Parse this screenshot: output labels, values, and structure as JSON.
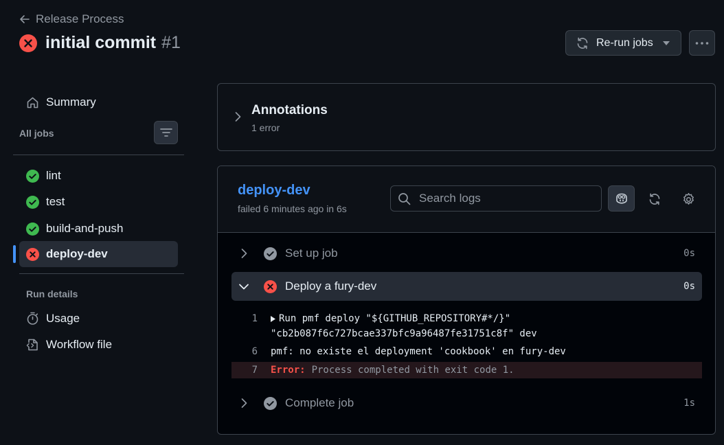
{
  "header": {
    "back_label": "Release Process",
    "title": "initial commit",
    "run_number": "#1",
    "rerun_label": "Re-run jobs"
  },
  "sidebar": {
    "summary_label": "Summary",
    "all_jobs_label": "All jobs",
    "jobs": [
      {
        "name": "lint",
        "status": "success"
      },
      {
        "name": "test",
        "status": "success"
      },
      {
        "name": "build-and-push",
        "status": "success"
      },
      {
        "name": "deploy-dev",
        "status": "failure"
      }
    ],
    "run_details_label": "Run details",
    "usage_label": "Usage",
    "workflow_file_label": "Workflow file"
  },
  "annotations": {
    "title": "Annotations",
    "subtitle": "1 error"
  },
  "job": {
    "name": "deploy-dev",
    "status_text": "failed 6 minutes ago in 6s",
    "search_placeholder": "Search logs",
    "steps": [
      {
        "label": "Set up job",
        "time": "0s"
      },
      {
        "label": "Deploy a fury-dev",
        "time": "0s"
      },
      {
        "label": "Complete job",
        "time": "1s"
      }
    ],
    "log": {
      "line1_no": "1",
      "line1_a": "Run pmf deploy \"${GITHUB_REPOSITORY#*/}\"",
      "line1_b": "\"cb2b087f6c727bcae337bfc9a96487fe31751c8f\" dev",
      "line6_no": "6",
      "line6": "pmf: no existe el deployment 'cookbook' en fury-dev",
      "line7_no": "7",
      "line7_err": "Error:",
      "line7_msg": "Process completed with exit code 1."
    }
  },
  "colors": {
    "background": "#0d1117",
    "success": "#3fb950",
    "failure": "#f85149",
    "accent": "#4493f8",
    "muted": "#9198a1"
  },
  "icons": {
    "back": "arrow-left-icon",
    "failed": "x-circle-fill-icon",
    "success": "check-circle-fill-icon",
    "rerun": "sync-icon",
    "more": "kebab-horizontal-icon",
    "summary": "home-icon",
    "filter": "filter-icon",
    "usage": "stopwatch-icon",
    "workflow": "file-code-icon",
    "search": "search-icon",
    "copilot": "copilot-icon",
    "refresh": "sync-icon",
    "settings": "gear-icon"
  }
}
